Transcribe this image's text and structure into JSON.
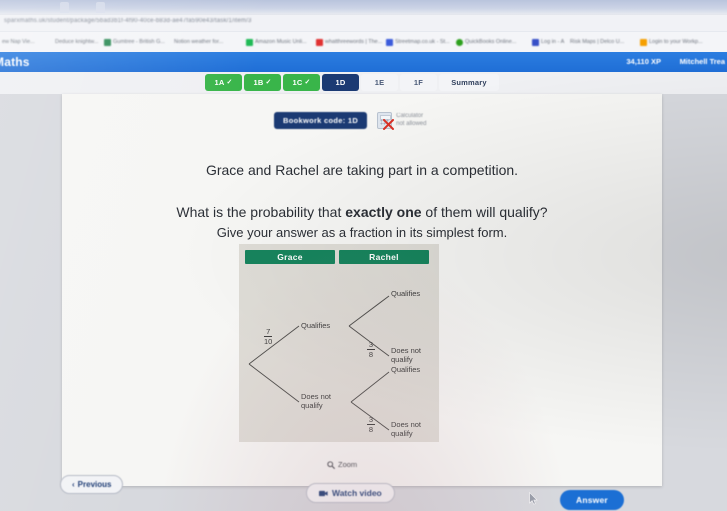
{
  "browser": {
    "address_bar_text": "sparxmaths.uk/student/package/5bad3b1f-4f90-40ce-b83d-ae47fa590e43/task/1/item/3",
    "bookmarks": [
      {
        "label": "ew Nap Vie...",
        "color": "#7a8396"
      },
      {
        "label": "Deduce knightw...",
        "color": "#7a8396"
      },
      {
        "label": "Gumtree - British G...",
        "color": "#2e8b57"
      },
      {
        "label": "Notion weather for...",
        "color": "#9aa3b2"
      },
      {
        "label": "Amazon Music Unli...",
        "color": "#1db954"
      },
      {
        "label": "whatthreewords | The...",
        "color": "#e03131"
      },
      {
        "label": "Streetmap.co.uk - St...",
        "color": "#3b5bdb"
      },
      {
        "label": "QuickBooks Online...",
        "color": "#2ca01c"
      },
      {
        "label": "Log in - A",
        "color": "#364fc7"
      },
      {
        "label": "Risk Maps | Delco U...",
        "color": "#495057"
      },
      {
        "label": "Login to your Workp...",
        "color": "#f59f00"
      }
    ]
  },
  "app_header": {
    "logo": "Maths",
    "xp": "34,110 XP",
    "user_name": "Mitchell Trea"
  },
  "task_tabs": [
    {
      "label": "1A",
      "state": "done",
      "tick": "✓"
    },
    {
      "label": "1B",
      "state": "done",
      "tick": "✓"
    },
    {
      "label": "1C",
      "state": "done",
      "tick": "✓"
    },
    {
      "label": "1D",
      "state": "active",
      "tick": ""
    },
    {
      "label": "1E",
      "state": "todo",
      "tick": ""
    },
    {
      "label": "1F",
      "state": "todo",
      "tick": ""
    },
    {
      "label": "Summary",
      "state": "summary",
      "tick": ""
    }
  ],
  "question": {
    "bookwork_code": "Bookwork code: 1D",
    "calculator_line_1": "Calculator",
    "calculator_line_2": "not allowed",
    "line_1": "Grace and Rachel are taking part in a competition.",
    "line_2_before": "What is the probability that ",
    "line_2_bold": "exactly one",
    "line_2_after": " of them will qualify?",
    "line_3": "Give your answer as a fraction in its simplest form."
  },
  "tree_diagram": {
    "column_headers": [
      "Grace",
      "Rachel"
    ],
    "grace_qualifies_prob": {
      "num": "7",
      "den": "10"
    },
    "rachel_not_qualify_prob_top": {
      "num": "3",
      "den": "8"
    },
    "rachel_not_qualify_prob_bottom": {
      "num": "3",
      "den": "8"
    },
    "labels": {
      "grace_qualifies": "Qualifies",
      "grace_not_qualify": "Does not\nqualify",
      "rachel_qualifies_top": "Qualifies",
      "rachel_not_qualify_top": "Does not\nqualify",
      "rachel_qualifies_bottom": "Qualifies",
      "rachel_not_qualify_bottom": "Does not\nqualify"
    }
  },
  "controls": {
    "zoom_label": "Zoom",
    "previous_label": "Previous",
    "previous_chevron": "‹",
    "watch_video_label": "Watch video",
    "answer_label": "Answer"
  },
  "colors": {
    "app_blue": "#1f6ed6",
    "tab_done_green": "#39b54a",
    "tab_active_navy": "#1b3a73",
    "diagram_green": "#17845d",
    "answer_blue": "#1b6fd4"
  }
}
